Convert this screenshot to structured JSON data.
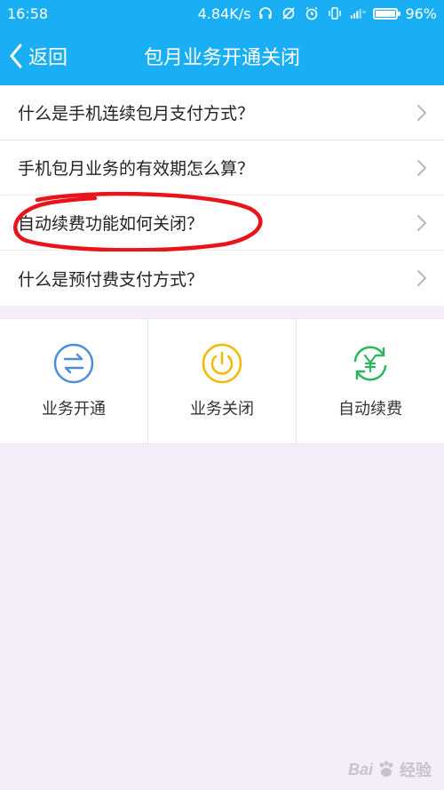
{
  "status_bar": {
    "time": "16:58",
    "speed": "4.84K/s",
    "battery_percent": "96%",
    "battery_level": 0.96,
    "icons": [
      "headphones-icon",
      "sync-off-icon",
      "alarm-icon",
      "vibrate-icon",
      "signal-icon",
      "battery-icon"
    ]
  },
  "nav": {
    "back_label": "返回",
    "title": "包月业务开通关闭"
  },
  "faq": [
    {
      "label": "什么是手机连续包月支付方式？"
    },
    {
      "label": "手机包月业务的有效期怎么算？"
    },
    {
      "label": "自动续费功能如何关闭？"
    },
    {
      "label": "什么是预付费支付方式？"
    }
  ],
  "actions": [
    {
      "label": "业务开通",
      "icon": "swap-icon",
      "color": "#4a90d9"
    },
    {
      "label": "业务关闭",
      "icon": "power-icon",
      "color": "#f5b800"
    },
    {
      "label": "自动续费",
      "icon": "yuan-refresh-icon",
      "color": "#2db55d"
    }
  ],
  "colors": {
    "header_bg": "#1aaef4",
    "annotation": "#e8141c"
  },
  "watermark": {
    "brand": "Bai",
    "site": "经验"
  }
}
